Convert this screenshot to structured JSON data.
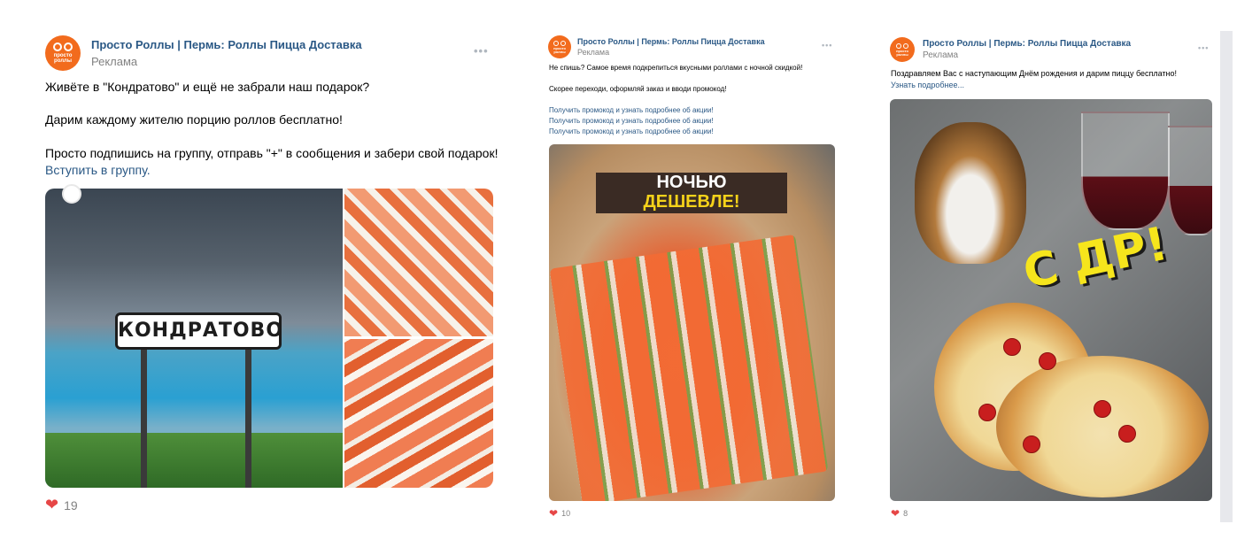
{
  "posts": [
    {
      "author": "Просто Роллы | Пермь: Роллы Пицца Доставка",
      "ad_label": "Реклама",
      "avatar_text": "просто роллы",
      "text_lines": [
        "Живёте в \"Кондратово\" и ещё не забрали наш подарок?",
        "Дарим каждому жителю порцию роллов бесплатно!",
        "Просто подпишись на группу, отправь \"+\" в сообщения и забери свой подарок!"
      ],
      "link": "Вступить в группу.",
      "sign_text": "КОНДРАТОВО",
      "likes": "19"
    },
    {
      "author": "Просто Роллы | Пермь: Роллы Пицца Доставка",
      "ad_label": "Реклама",
      "avatar_text": "просто роллы",
      "text_lines": [
        "Не спишь? Самое время подкрепиться вкусными роллами с ночной скидкой!",
        "Скорее переходи, оформляй заказ и вводи промокод!"
      ],
      "links": [
        "Получить промокод и узнать подробнее об акции!",
        "Получить промокод и узнать подробнее об акции!",
        "Получить промокод и узнать подробнее об акции!"
      ],
      "banner_line1": "НОЧЬЮ",
      "banner_line2": "ДЕШЕВЛЕ!",
      "likes": "10"
    },
    {
      "author": "Просто Роллы | Пермь: Роллы Пицца Доставка",
      "ad_label": "Реклама",
      "avatar_text": "просто роллы",
      "text_lines": [
        "Поздравляем Вас с наступающим Днём рождения и дарим пиццу бесплатно!"
      ],
      "link": "Узнать подробнее...",
      "image_text": "С ДР!",
      "likes": "8"
    }
  ],
  "colors": {
    "link": "#2a5885",
    "muted": "#828282",
    "like": "#e64646",
    "avatar": "#f26b1d"
  },
  "icons": [
    "avatar-logo",
    "more-icon",
    "heart-icon"
  ]
}
